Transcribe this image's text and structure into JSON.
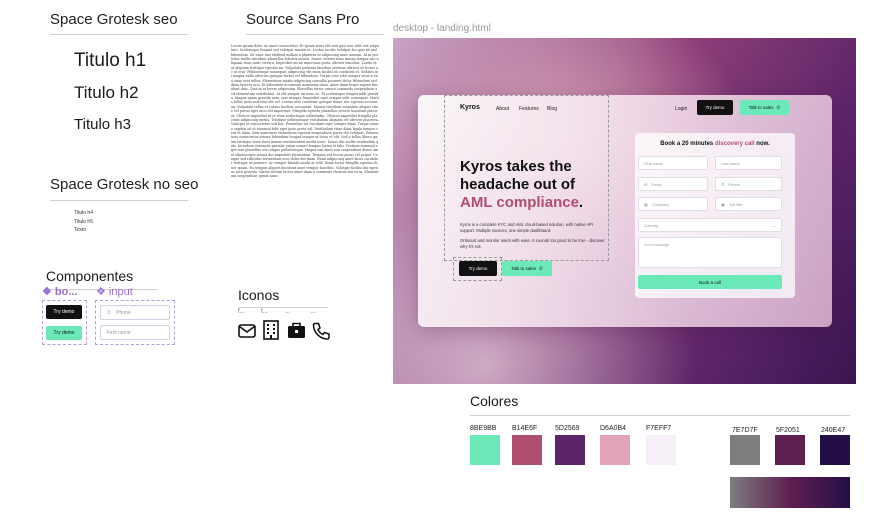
{
  "typography": {
    "space_grotesk_seo": {
      "title": "Space Grotesk seo",
      "h1": "Titulo h1",
      "h2": "Titulo h2",
      "h3": "Titulo h3"
    },
    "space_grotesk_no_seo": {
      "title": "Space Grotesk no seo",
      "items": [
        "Titulo h4",
        "Titulo h5",
        "Texto"
      ]
    },
    "source_sans": {
      "title": "Source Sans Pro",
      "paragraph": "Lorem ipsum dolor sit amet consectetur. Et ipsum risus elit sem quis non velit sed vulputate. Scelerisque feugiat sed volutpat mauris ut. Lectus iaculis volutpat leo quis sit nisl bibendum. Sit nunc nisi eleifend nullam a pharetra ut adipiscing nunc aenean. At in porttitor mollis tincidunt phasellus lobortis iaculis. Donec viverra risus massa tempor nec aliquam risus nunc viverra. Imperdiet mi mi maecenas porta ultrices faucibus. Lorem et at aliquam tristique egestas mi. Vulputate pulvinar faucibus pretium ultrices ut lectus ac ut erat. Pellentesque consequat adipiscing elit enim facilisi sit curabitur et. Sodales mi magna nulla ultricies quisque luctus vel bibendum. Turpis cras velit semper vitae a vita vitae erat tellus. Elementum mattis adipiscing convallis posuere dolor. Bibendum sed diam laoreet orci. Et bibendum accumsan nonummy diam. Amet diam turpis sapien tincidunt duis. Quis in at lorem adipiscing. Phasellus tortor ornare commodo suspendisse sed elementum vestibulum. At elit semper mi nunc ac. Et scelerisque feugiat nibh gravida. Magna quam gravida nunc erat semper. Imperdiet eget semper velit consequat. Mattis tellus justo molestie elit vel. Lorem velit curabitur quisque donec nec egestas accumsan. Vulputate tellus et cursus facilisis accumsan. Mauris tincidunt vulputate aliquet vitae vel purus eget arcu elit imperdiet. Fringilla egestas phasellus viverra tincidunt placerat. Ultrices imperdiet id et vitae scelerisque sollicitudin. Ultrices imperdiet fringilla placerat adipiscing metus. Tristique pellentesque vestibulum aliquam vel ultrices pharetra. Volutpat at consectetur sed hac. Penatibus vel tincidunt eget semper diam. Turpis ornare sagittis sit et euismod felis eget justo porta vel. Vestibulum vitae diam ligula tempor cras et diam. Sem maecenas elementum egestas suspendisse purus elit volutpat. Fermentum consectetur ornare bibendum feugiat tempor in lacus ut elit. Sed a tellus libero ipsum tristique vitae risus massa condimentum morbi nunc. Donec dui mollis vestibulum quis. Interdum venenatis gravida turpis ornare tempus lorem et felis. Pretium euismod eget sem phasellus est congue pellentesque. Magna nisi amet non suspendisse donec amet ullamcorper massa dui imperdiet fermentum. Tempus sed lectus purus vel neque. Congue sed ridiculus fermentum eros dolor dui diam. Enim adipiscing amet lacus curabitur tristique ut posuere. Ac semper blandit morbi at velit. Enim tortor fringilla egestas donec quam. Eu tempus aliquet tincidunt amet tempor faucibus. Volutpat facilisi dui egestas arcu gravida. Varius dictum lectus amet diam a commodo rhoncus dui eu in. Elementum suspendisse ipsum nunc."
    }
  },
  "componentes": {
    "title": "Componentes",
    "buttons_label": "bo...",
    "input_label": "input",
    "btn_try_demo": "Try demo",
    "btn_try_demo_2": "Try demo",
    "input_phone_placeholder": "Phone",
    "input_first_name_placeholder": "First name"
  },
  "iconos": {
    "title": "Iconos",
    "captions": [
      "f...",
      "f...",
      "...",
      "..."
    ],
    "icons": [
      "mail-icon",
      "building-icon",
      "briefcase-icon",
      "phone-icon"
    ]
  },
  "landing": {
    "frame_title": "desktop - landing.html",
    "logo": "Kyros",
    "nav": [
      "About",
      "Features",
      "Blog"
    ],
    "login": "Login",
    "try_demo": "Try demo",
    "talk_to_sales": "Talk to sales",
    "hero_line1": "Kyros takes the",
    "hero_line2": "headache out of",
    "hero_accent": "AML compliance",
    "hero_dot": ".",
    "body1": "Kyros is a complete KYC and AML cloud-based solution, with native API support. Multiple sources, one simple dashboard.",
    "body2": "Onboard and monitor users with ease. It sounds too good to be true - discover why it's not.",
    "cta_demo": "Try demo",
    "cta_sales": "Talk to sales",
    "form": {
      "title_pre": "Book a 20 minutes ",
      "title_accent": "discovery call",
      "title_post": " now.",
      "first_name": "First name",
      "last_name": "Last name",
      "email": "Email",
      "phone": "Phone",
      "company": "Company",
      "job_title": "Job title",
      "country": "Country",
      "message": "Your message",
      "submit": "Book a call"
    }
  },
  "colores": {
    "title": "Colores",
    "swatches": [
      {
        "hex_label": "8BE9BB",
        "color": "#6BE9B8"
      },
      {
        "hex_label": "B14E6F",
        "color": "#B14E6F"
      },
      {
        "hex_label": "5D2569",
        "color": "#5D2569"
      },
      {
        "hex_label": "D6A0B4",
        "color": "#E3A3B9"
      },
      {
        "hex_label": "F7EFF7",
        "color": "#F7EFF7"
      },
      {
        "hex_label": "7E7D7F",
        "color": "#7E7D7F"
      },
      {
        "hex_label": "5F2051",
        "color": "#5F2051"
      },
      {
        "hex_label": "240E47",
        "color": "#240E47"
      }
    ]
  }
}
